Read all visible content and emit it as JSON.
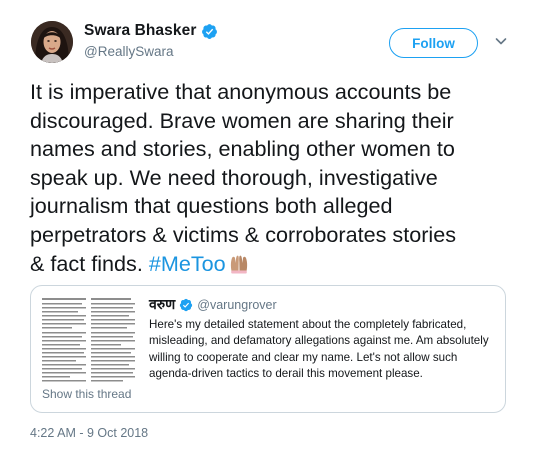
{
  "author": {
    "display_name": "Swara Bhasker",
    "handle": "@ReallySwara",
    "verified": true
  },
  "actions": {
    "follow_label": "Follow"
  },
  "tweet": {
    "lines": [
      "It is imperative that anonymous accounts be",
      "discouraged. Brave women are sharing their",
      "names and stories, enabling other women to",
      "speak up. We need thorough, investigative",
      "journalism that questions both alleged",
      "perpetrators & victims & corroborates stories",
      "& fact finds. "
    ],
    "hashtag": "#MeToo",
    "emoji": "raised-hands-icon"
  },
  "quoted_tweet": {
    "display_name": "वरुण",
    "handle": "@varungrover",
    "verified": true,
    "lines": [
      "Here's my detailed statement about the completely fabricated,",
      "misleading, and defamatory allegations against me. Am absolutely",
      "willing to cooperate and clear my name. Let's not allow such",
      "agenda-driven tactics to derail this movement please."
    ],
    "show_thread_label": "Show this thread"
  },
  "timestamp": "4:22 AM - 9 Oct 2018",
  "colors": {
    "accent": "#1da1f2",
    "hashtag": "#1b95e0",
    "muted": "#657786",
    "border": "#ccd6dd"
  }
}
